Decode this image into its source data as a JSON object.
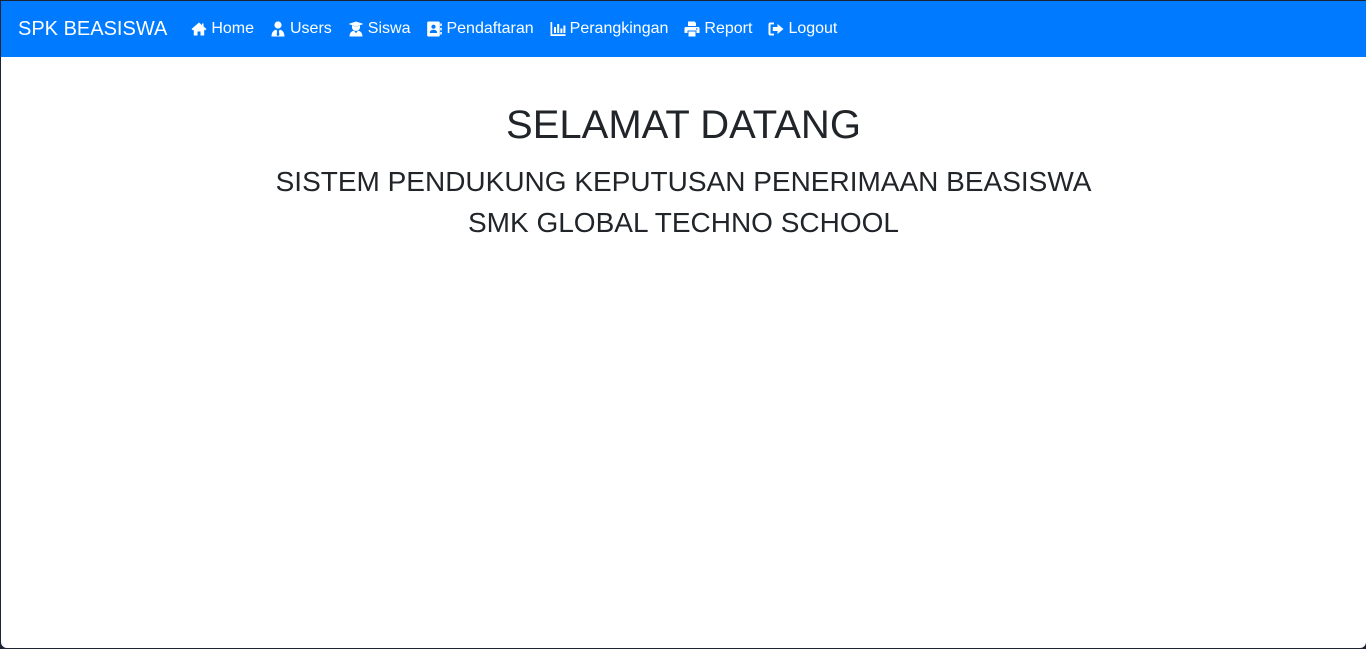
{
  "navbar": {
    "brand": "SPK BEASISWA",
    "background": "#007bff",
    "items": [
      {
        "label": "Home",
        "icon": "home-icon"
      },
      {
        "label": "Users",
        "icon": "user-tie-icon"
      },
      {
        "label": "Siswa",
        "icon": "user-graduate-icon"
      },
      {
        "label": "Pendaftaran",
        "icon": "address-book-icon"
      },
      {
        "label": "Perangkingan",
        "icon": "chart-bar-icon"
      },
      {
        "label": "Report",
        "icon": "print-icon"
      },
      {
        "label": "Logout",
        "icon": "sign-out-icon"
      }
    ]
  },
  "main": {
    "title": "SELAMAT DATANG",
    "subtitle": "SISTEM PENDUKUNG KEPUTUSAN PENERIMAAN BEASISWA",
    "school": "SMK GLOBAL TECHNO SCHOOL"
  }
}
